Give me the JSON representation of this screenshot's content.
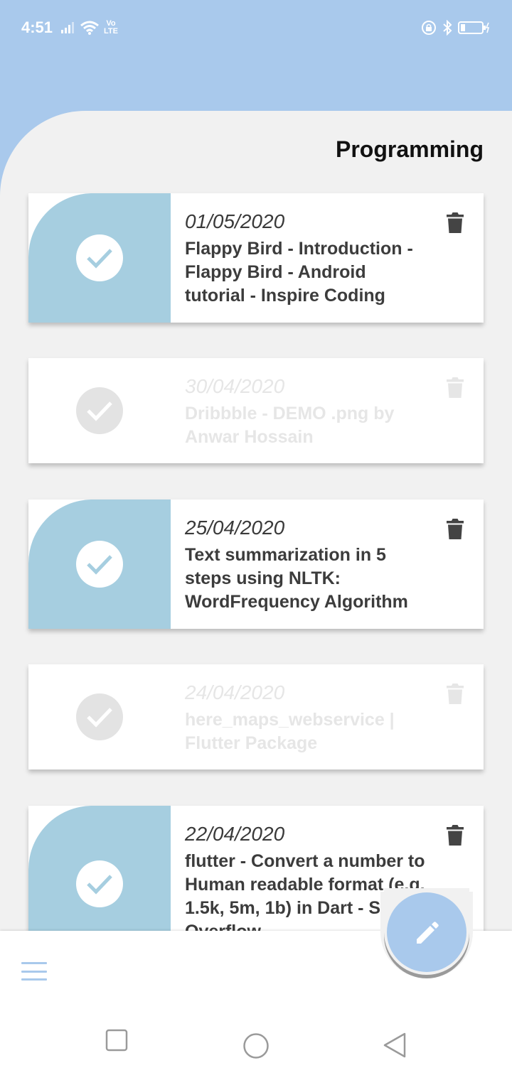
{
  "status_bar": {
    "time": "4:51",
    "network_label": "Vo\nLTE"
  },
  "page": {
    "title": "Programming"
  },
  "notes": [
    {
      "date": "01/05/2020",
      "title": "Flappy Bird - Introduction - Flappy Bird - Android tutorial - Inspire Coding",
      "checked": true
    },
    {
      "date": "30/04/2020",
      "title": "Dribbble - DEMO .png by Anwar Hossain",
      "checked": false
    },
    {
      "date": "25/04/2020",
      "title": "Text summarization in 5 steps using NLTK: WordFrequency Algorithm",
      "checked": true
    },
    {
      "date": "24/04/2020",
      "title": "here_maps_webservice | Flutter Package",
      "checked": false
    },
    {
      "date": "22/04/2020",
      "title": "flutter - Convert a number to Human readable format (e.g. 1.5k, 5m, 1b) in Dart - Stack Overflow",
      "checked": true
    }
  ],
  "colors": {
    "accent": "#a9c9ec",
    "card_check_bg": "#a6cee0",
    "background": "#f1f1f1"
  },
  "icons": {
    "menu": "menu-icon",
    "edit": "pencil-icon",
    "delete": "trash-icon",
    "check": "check-icon"
  }
}
